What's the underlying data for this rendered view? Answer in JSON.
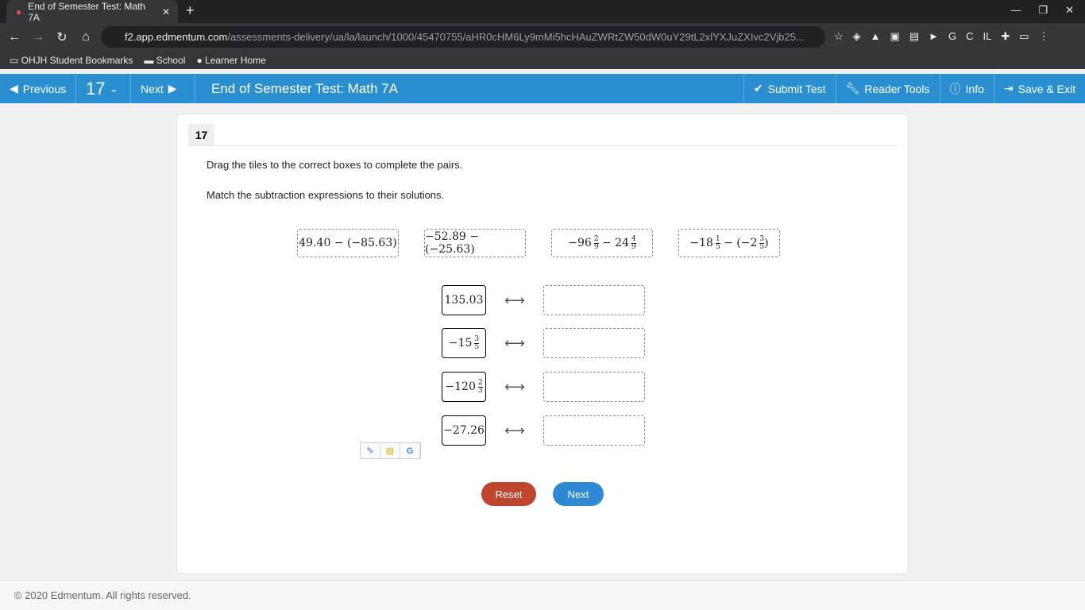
{
  "browser": {
    "tab_title": "End of Semester Test: Math 7A",
    "url_host": "f2.app.edmentum.com",
    "url_path": "/assessments-delivery/ua/la/launch/1000/45470755/aHR0cHM6Ly9mMi5hcHAuZWRtZW50dW0uY29tL2xlYXJuZXIvc2Vjb25...",
    "bookmarks": [
      "OHJH Student Bookmarks",
      "School",
      "Learner Home"
    ]
  },
  "nav": {
    "previous": "Previous",
    "question_number": "17",
    "next": "Next",
    "title": "End of Semester Test: Math 7A",
    "submit": "Submit Test",
    "reader_tools": "Reader Tools",
    "info": "Info",
    "save_exit": "Save & Exit",
    "accent": "#2a8fd1"
  },
  "question": {
    "number": "17",
    "instruction1": "Drag the tiles to the correct boxes to complete the pairs.",
    "instruction2": "Match the subtraction expressions to their solutions.",
    "tiles": [
      {
        "text": "49.40 − (−85.63)"
      },
      {
        "text": "−52.89 − (−25.63)"
      },
      {
        "a": "−96",
        "an": "2",
        "ad": "9",
        "op": "− 24",
        "bn": "4",
        "bd": "9"
      },
      {
        "a": "−18",
        "an": "1",
        "ad": "5",
        "op": "− (−2",
        "bn": "3",
        "bd": "5",
        "close": ")"
      }
    ],
    "answers": [
      {
        "whole": "135.03"
      },
      {
        "whole": "−15",
        "num": "3",
        "den": "5"
      },
      {
        "whole": "−120",
        "num": "2",
        "den": "3"
      },
      {
        "whole": "−27.26"
      }
    ]
  },
  "buttons": {
    "reset": "Reset",
    "next": "Next",
    "reset_color": "#c0452f",
    "next_color": "#2f8ad6"
  },
  "footer": "© 2020 Edmentum. All rights reserved."
}
